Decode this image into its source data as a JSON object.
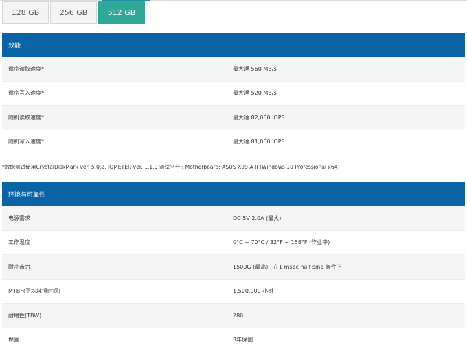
{
  "capacity_tabs": [
    {
      "label": "128 GB",
      "selected": false
    },
    {
      "label": "256 GB",
      "selected": false
    },
    {
      "label": "512 GB",
      "selected": true
    }
  ],
  "performance": {
    "title": "效能",
    "rows": [
      {
        "label": "循序读取速度*",
        "value": "最大達 560 MB/s"
      },
      {
        "label": "循序写入速度*",
        "value": "最大達 520 MB/s"
      },
      {
        "label": "随机读取速度*",
        "value": "最大達 82,000 IOPS"
      },
      {
        "label": "随机写入速度*",
        "value": "最大達 81,000 IOPS"
      }
    ]
  },
  "footnote": "*效能测试使用CrystalDiskMark ver. 5.0.2, IOMETER ver. 1.1.0 测试平台 : Motherboard: ASUS X99-A II (Windows 10 Professional x64)",
  "environment": {
    "title": "环境与可靠性",
    "rows": [
      {
        "label": "电源需求",
        "value": "DC 5V 2.0A (最大)"
      },
      {
        "label": "工作温度",
        "value": "0°C ~ 70°C / 32°F ~ 158°F (作业中)"
      },
      {
        "label": "耐冲击力",
        "value": "1500G (最高) , 在1 msec half-sine 条件下"
      },
      {
        "label": "MTBF(平均耗损时间)",
        "value": "1,500,000 小时"
      },
      {
        "label": "耐用性(TBW)",
        "value": "280"
      },
      {
        "label": "保固",
        "value": "3年保固"
      }
    ]
  },
  "colors": {
    "header_bg": "#0a63a5",
    "active_tab": "#2fa89a"
  }
}
